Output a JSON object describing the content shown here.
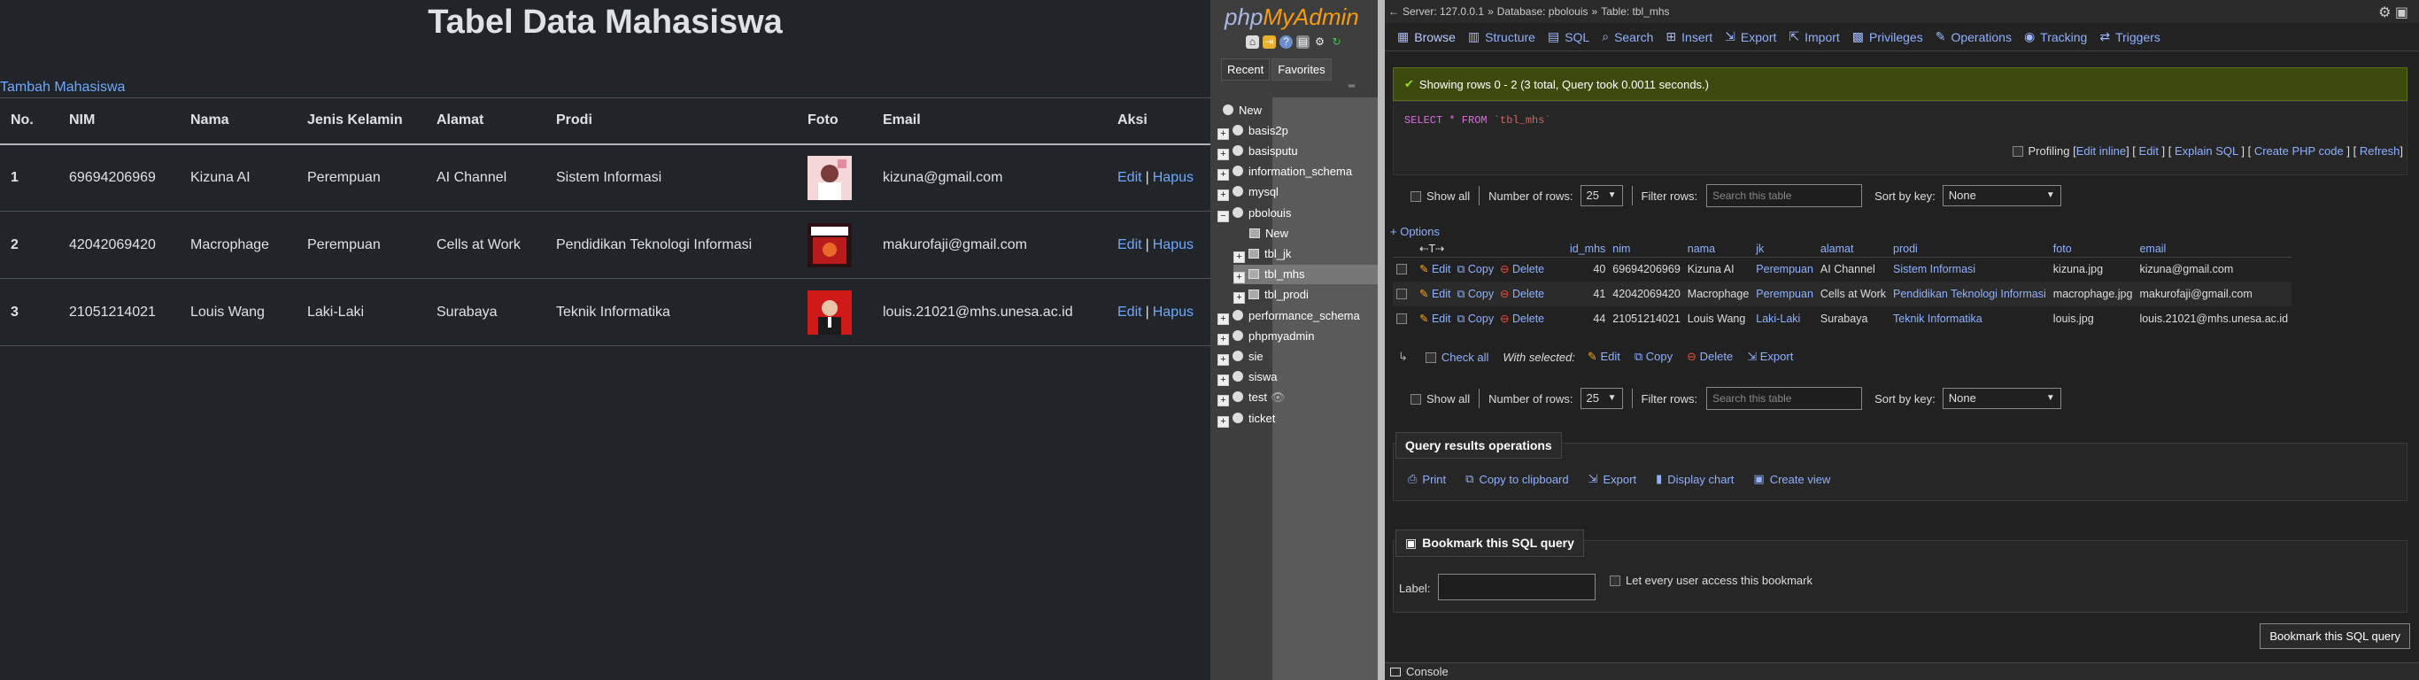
{
  "app": {
    "title": "Tabel Data Mahasiswa",
    "add_link": "Tambah Mahasiswa",
    "columns": [
      "No.",
      "NIM",
      "Nama",
      "Jenis Kelamin",
      "Alamat",
      "Prodi",
      "Foto",
      "Email",
      "Aksi"
    ],
    "rows": [
      {
        "no": "1",
        "nim": "69694206969",
        "nama": "Kizuna AI",
        "jk": "Perempuan",
        "alamat": "AI Channel",
        "prodi": "Sistem Informasi",
        "email": "kizuna@gmail.com",
        "photo_color": "#f3c5c8"
      },
      {
        "no": "2",
        "nim": "42042069420",
        "nama": "Macrophage",
        "jk": "Perempuan",
        "alamat": "Cells at Work",
        "prodi": "Pendidikan Teknologi Informasi",
        "email": "makurofaji@gmail.com",
        "photo_color": "#b81b1b"
      },
      {
        "no": "3",
        "nim": "21051214021",
        "nama": "Louis Wang",
        "jk": "Laki-Laki",
        "alamat": "Surabaya",
        "prodi": "Teknik Informatika",
        "email": "louis.21021@mhs.unesa.ac.id",
        "photo_color": "#d01a1a"
      }
    ],
    "edit_label": "Edit",
    "delete_label": "Hapus",
    "separator": "|"
  },
  "pma_nav": {
    "logo_php": "php",
    "logo_myadmin": "MyAdmin",
    "tab_recent": "Recent",
    "tab_favorites": "Favorites",
    "tree": {
      "new": "New",
      "basis2p": "basis2p",
      "basisputu": "basisputu",
      "information_schema": "information_schema",
      "mysql": "mysql",
      "pbolouis": "pbolouis",
      "pbolouis_new": "New",
      "tbl_jk": "tbl_jk",
      "tbl_mhs": "tbl_mhs",
      "tbl_prodi": "tbl_prodi",
      "performance_schema": "performance_schema",
      "phpmyadmin": "phpmyadmin",
      "sie": "sie",
      "siswa": "siswa",
      "test": "test",
      "ticket": "ticket"
    }
  },
  "pma_main": {
    "breadcrumb": {
      "server": "Server: 127.0.0.1",
      "database": "Database: pbolouis",
      "table": "Table: tbl_mhs",
      "sep": "»"
    },
    "tabs": {
      "browse": "Browse",
      "structure": "Structure",
      "sql": "SQL",
      "search": "Search",
      "insert": "Insert",
      "export": "Export",
      "import": "Import",
      "privileges": "Privileges",
      "operations": "Operations",
      "tracking": "Tracking",
      "triggers": "Triggers"
    },
    "success_message": "Showing rows 0 - 2 (3 total, Query took 0.0011 seconds.)",
    "sql_keyword": "SELECT * FROM",
    "sql_table": "`tbl_mhs`",
    "sql_links": {
      "profiling": "Profiling",
      "edit_inline": "Edit inline",
      "edit": "Edit",
      "explain": "Explain SQL",
      "php": "Create PHP code",
      "refresh": "Refresh"
    },
    "nav": {
      "show_all": "Show all",
      "num_rows_label": "Number of rows:",
      "num_rows_value": "25",
      "filter_label": "Filter rows:",
      "filter_placeholder": "Search this table",
      "sort_label": "Sort by key:",
      "sort_value": "None"
    },
    "options_link": "+ Options",
    "result_columns": [
      "id_mhs",
      "nim",
      "nama",
      "jk",
      "alamat",
      "prodi",
      "foto",
      "email"
    ],
    "result_rows": [
      {
        "id": "40",
        "nim": "69694206969",
        "nama": "Kizuna AI",
        "jk": "Perempuan",
        "alamat": "AI Channel",
        "prodi": "Sistem Informasi",
        "foto": "kizuna.jpg",
        "email": "kizuna@gmail.com"
      },
      {
        "id": "41",
        "nim": "42042069420",
        "nama": "Macrophage",
        "jk": "Perempuan",
        "alamat": "Cells at Work",
        "prodi": "Pendidikan Teknologi Informasi",
        "foto": "macrophage.jpg",
        "email": "makurofaji@gmail.com"
      },
      {
        "id": "44",
        "nim": "21051214021",
        "nama": "Louis Wang",
        "jk": "Laki-Laki",
        "alamat": "Surabaya",
        "prodi": "Teknik Informatika",
        "foto": "louis.jpg",
        "email": "louis.21021@mhs.unesa.ac.id"
      }
    ],
    "row_actions": {
      "edit": "Edit",
      "copy": "Copy",
      "delete": "Delete"
    },
    "with_selected": {
      "check_all": "Check all",
      "label": "With selected:",
      "edit": "Edit",
      "copy": "Copy",
      "delete": "Delete",
      "export": "Export"
    },
    "qro": {
      "title": "Query results operations",
      "print": "Print",
      "copy_clipboard": "Copy to clipboard",
      "export": "Export",
      "display_chart": "Display chart",
      "create_view": "Create view"
    },
    "bookmark": {
      "title": "Bookmark this SQL query",
      "label": "Label:",
      "share": "Let every user access this bookmark",
      "button": "Bookmark this SQL query"
    },
    "console": "Console"
  }
}
